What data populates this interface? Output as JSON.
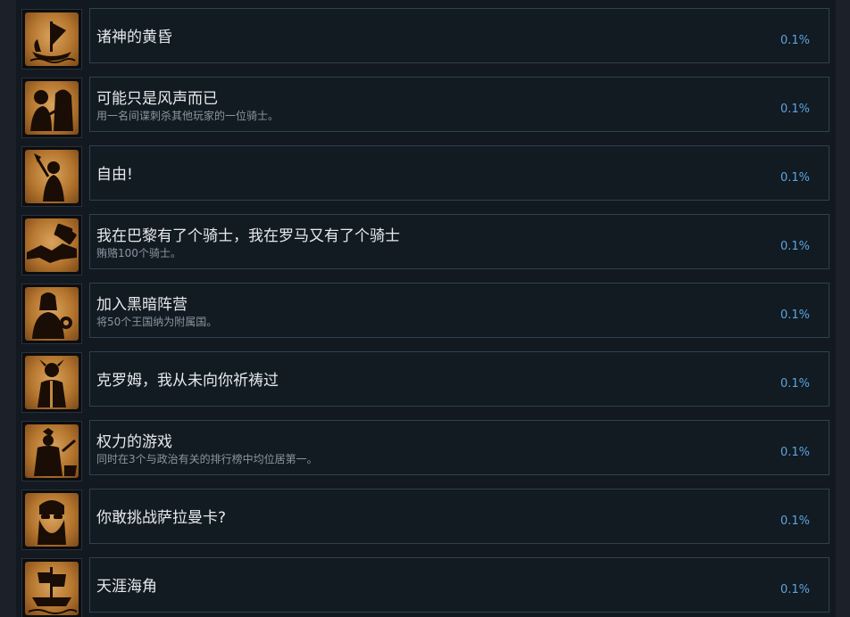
{
  "achievements": [
    {
      "title": "诸神的黄昏",
      "description": "",
      "percent": "0.1%",
      "icon": "viking-ship-icon"
    },
    {
      "title": "可能只是风声而已",
      "description": "用一名间谍刺杀其他玩家的一位骑士。",
      "percent": "0.1%",
      "icon": "assassin-spy-icon"
    },
    {
      "title": "自由!",
      "description": "",
      "percent": "0.1%",
      "icon": "freedom-warrior-icon"
    },
    {
      "title": "我在巴黎有了个骑士，我在罗马又有了个骑士",
      "description": "贿赂100个骑士。",
      "percent": "0.1%",
      "icon": "handshake-bribe-icon"
    },
    {
      "title": "加入黑暗阵营",
      "description": "将50个王国纳为附属国。",
      "percent": "0.1%",
      "icon": "dark-knight-icon"
    },
    {
      "title": "克罗姆，我从未向你祈祷过",
      "description": "",
      "percent": "0.1%",
      "icon": "barbarian-icon"
    },
    {
      "title": "权力的游戏",
      "description": "同时在3个与政治有关的排行榜中均位居第一。",
      "percent": "0.1%",
      "icon": "throne-battle-icon"
    },
    {
      "title": "你敢挑战萨拉曼卡?",
      "description": "",
      "percent": "0.1%",
      "icon": "bearded-man-sunglasses-icon"
    },
    {
      "title": "天涯海角",
      "description": "",
      "percent": "0.1%",
      "icon": "sailing-ship-icon"
    }
  ],
  "colors": {
    "background": "#1b2029",
    "card_background": "#121a22",
    "card_border": "#30414f",
    "title_text": "#e6e9ec",
    "description_text": "#8c95a0",
    "percent_text": "#5ba4e0",
    "parchment": "#c58a44"
  }
}
